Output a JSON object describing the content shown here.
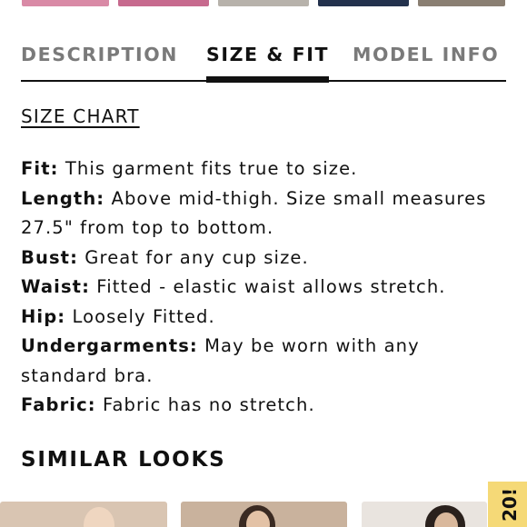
{
  "colors": {
    "accent": "#111111",
    "inactive_tab": "#7a7a7a",
    "promo_bg": "#f5d977"
  },
  "tabs": [
    {
      "label": "DESCRIPTION",
      "active": false
    },
    {
      "label": "SIZE & FIT",
      "active": true
    },
    {
      "label": "MODEL INFO",
      "active": false
    }
  ],
  "size_chart_link": "SIZE CHART",
  "specs": [
    {
      "label": "Fit:",
      "text": "This garment fits true to size."
    },
    {
      "label": "Length:",
      "text": "Above mid-thigh. Size small measures 27.5\" from top to bottom."
    },
    {
      "label": "Bust:",
      "text": "Great for any cup size."
    },
    {
      "label": "Waist:",
      "text": "Fitted - elastic waist allows stretch."
    },
    {
      "label": "Hip:",
      "text": "Loosely Fitted."
    },
    {
      "label": "Undergarments:",
      "text": "May be worn with any standard bra."
    },
    {
      "label": "Fabric:",
      "text": "Fabric has no stretch."
    }
  ],
  "similar_looks_title": "SIMILAR LOOKS",
  "promo_tab_text": "20!"
}
